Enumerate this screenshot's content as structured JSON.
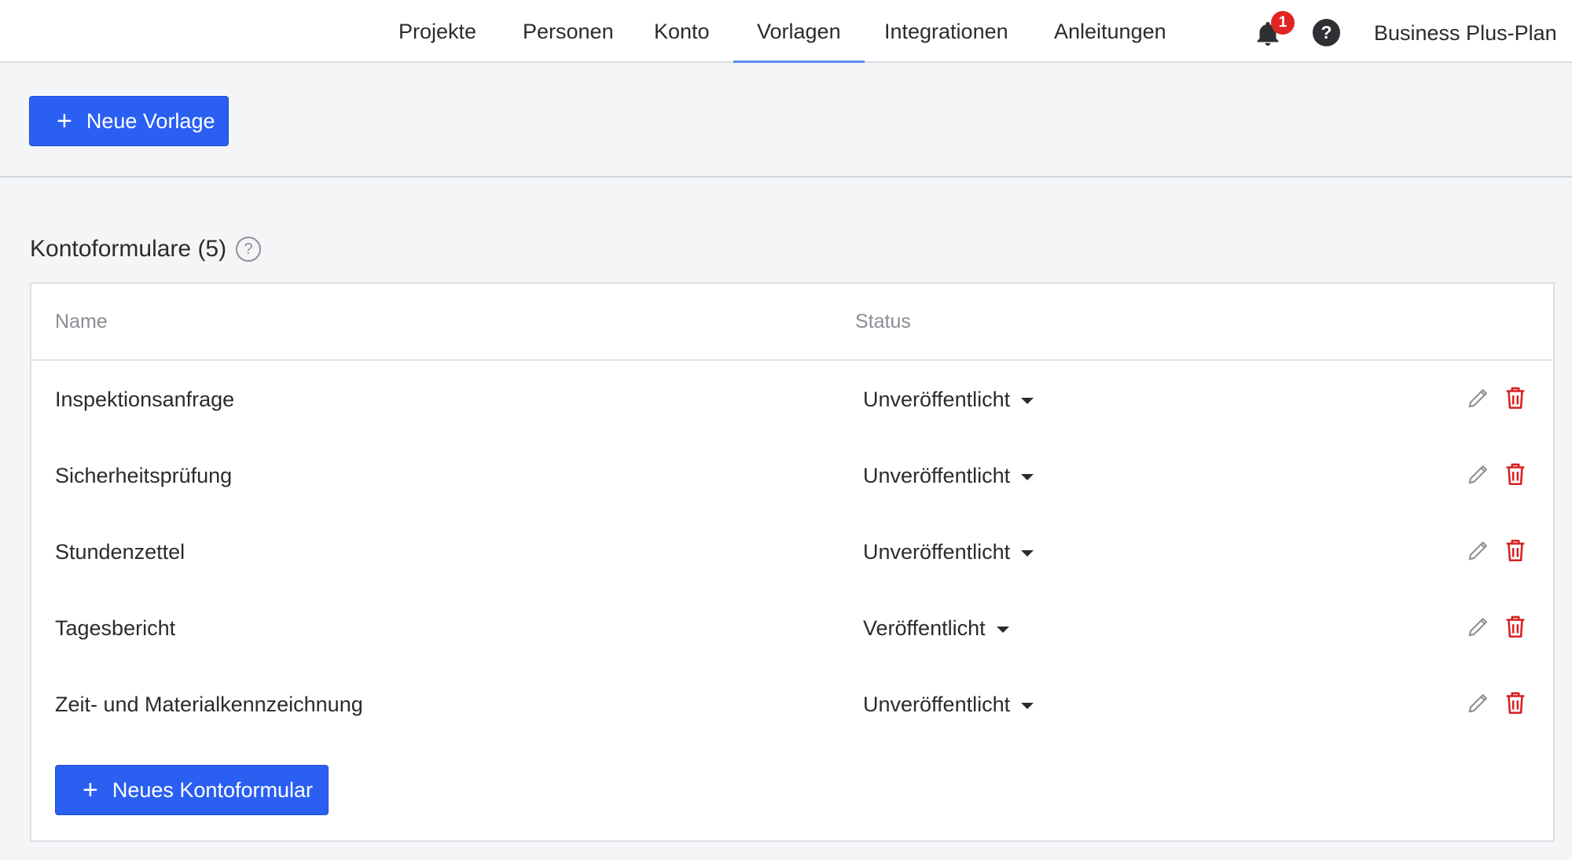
{
  "nav": {
    "tabs": [
      {
        "label": "Projekte",
        "active": false
      },
      {
        "label": "Personen",
        "active": false
      },
      {
        "label": "Konto",
        "active": false
      },
      {
        "label": "Vorlagen",
        "active": true
      },
      {
        "label": "Integrationen",
        "active": false
      },
      {
        "label": "Anleitungen",
        "active": false
      }
    ],
    "notification_count": "1",
    "help_label": "?",
    "plan_label": "Business Plus-Plan",
    "active_color": "#5b8ef0",
    "badge_color": "#e02424"
  },
  "toolbar": {
    "new_template_label": "Neue Vorlage",
    "plus_symbol": "+"
  },
  "section": {
    "title": "Kontoformulare (5)",
    "help_label": "?"
  },
  "table": {
    "headers": {
      "name": "Name",
      "status": "Status"
    },
    "rows": [
      {
        "name": "Inspektionsanfrage",
        "status": "Unveröffentlicht"
      },
      {
        "name": "Sicherheitsprüfung",
        "status": "Unveröffentlicht"
      },
      {
        "name": "Stundenzettel",
        "status": "Unveröffentlicht"
      },
      {
        "name": "Tagesbericht",
        "status": "Veröffentlicht"
      },
      {
        "name": "Zeit- und Materialkennzeichnung",
        "status": "Unveröffentlicht"
      }
    ],
    "row_actions": {
      "edit_icon": "pencil-icon",
      "delete_icon": "trash-icon",
      "delete_color": "#d92020"
    }
  },
  "footer": {
    "new_form_label": "Neues Kontoformular",
    "plus_symbol": "+"
  },
  "colors": {
    "primary_button": "#2a5ff2",
    "background": "#f4f5f7"
  }
}
